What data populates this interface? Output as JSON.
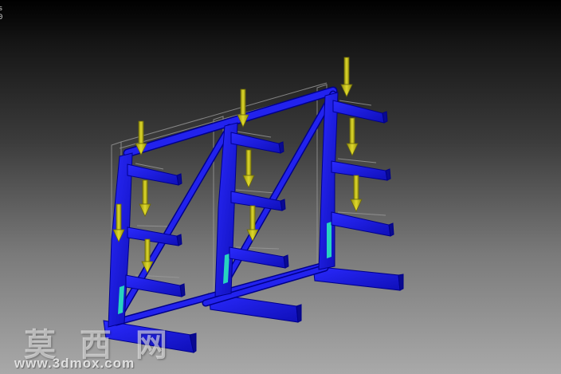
{
  "viewport": {
    "corner_label": "s\n0",
    "background_top": "#000000",
    "background_bottom": "#a9a9a9"
  },
  "model": {
    "frame_color": "#1a1adf",
    "frame_edge_color": "#00008a",
    "stress_highlight_color": "#27d3c0",
    "arrow_color": "#c8c21a",
    "arrow_edge_color": "#6b6808",
    "load_arrow_count": 9,
    "upright_count": 3
  },
  "watermark": {
    "site_name": "莫 西 网",
    "url": "www.3dmox.com"
  }
}
